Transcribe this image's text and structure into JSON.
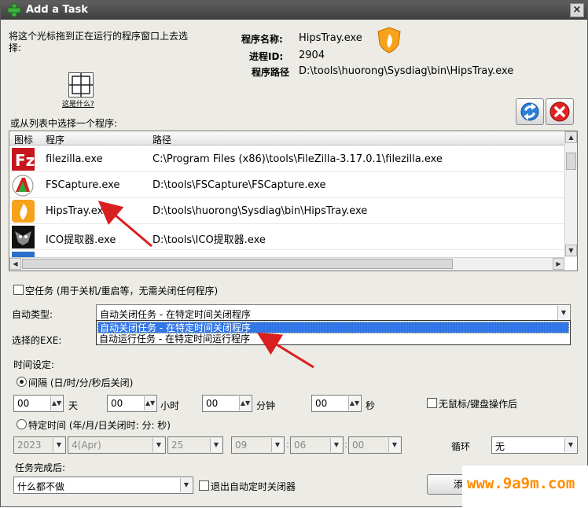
{
  "window": {
    "title": "Add a Task",
    "close_glyph": "×"
  },
  "finder": {
    "instruction": "将这个光标拖到正在运行的程序窗口上去选择:",
    "what_is_this": "这是什么?"
  },
  "process_info": {
    "name_label": "程序名称:",
    "name_value": "HipsTray.exe",
    "pid_label": "进程ID:",
    "pid_value": "2904",
    "path_label": "程序路径",
    "path_value": "D:\\tools\\huorong\\Sysdiag\\bin\\HipsTray.exe"
  },
  "list": {
    "caption": "或从列表中选择一个程序:",
    "columns": [
      "图标",
      "程序",
      "路径"
    ],
    "rows": [
      {
        "name": "filezilla.exe",
        "path": "C:\\Program Files (x86)\\tools\\FileZilla-3.17.0.1\\filezilla.exe",
        "icon": "filezilla-icon"
      },
      {
        "name": "FSCapture.exe",
        "path": "D:\\tools\\FSCapture\\FSCapture.exe",
        "icon": "fscapture-icon"
      },
      {
        "name": "HipsTray.exe",
        "path": "D:\\tools\\huorong\\Sysdiag\\bin\\HipsTray.exe",
        "icon": "huorong-shield-icon"
      },
      {
        "name": "ICO提取器.exe",
        "path": "D:\\tools\\ICO提取器.exe",
        "icon": "ico-extractor-icon"
      }
    ]
  },
  "empty_task": {
    "label": "空任务 (用于关机/重启等，无需关闭任何程序)"
  },
  "auto_type": {
    "label": "自动类型:",
    "value": "自动关闭任务 - 在特定时间关闭程序",
    "options": [
      "自动关闭任务 - 在特定时间关闭程序",
      "自动运行任务 - 在特定时间运行程序"
    ]
  },
  "selected_exe": {
    "label": "选择的EXE:"
  },
  "time_settings": {
    "label": "时间设定:",
    "interval_label": "间隔 (日/时/分/秒后关闭)",
    "days_value": "00",
    "days_unit": "天",
    "hours_value": "00",
    "hours_unit": "小时",
    "minutes_value": "00",
    "minutes_unit": "分钟",
    "seconds_value": "00",
    "seconds_unit": "秒",
    "idle_label": "无鼠标/键盘操作后",
    "specific_label": "特定时间 (年/月/日关闭时: 分: 秒)",
    "year": "2023",
    "month": "4(Apr)",
    "day": "25",
    "hour": "09",
    "minute": "06",
    "second": "00",
    "loop_label": "循环",
    "loop_value": "无"
  },
  "after_task": {
    "label": "任务完成后:",
    "value": "什么都不做",
    "exit_label": "退出自动定时关闭器"
  },
  "add_button": {
    "label": "添"
  },
  "watermark": {
    "text": "www.9a9m.com"
  },
  "colors": {
    "accent": "#d92020",
    "selection": "#3276e8",
    "watermark": "#ff8c00"
  }
}
